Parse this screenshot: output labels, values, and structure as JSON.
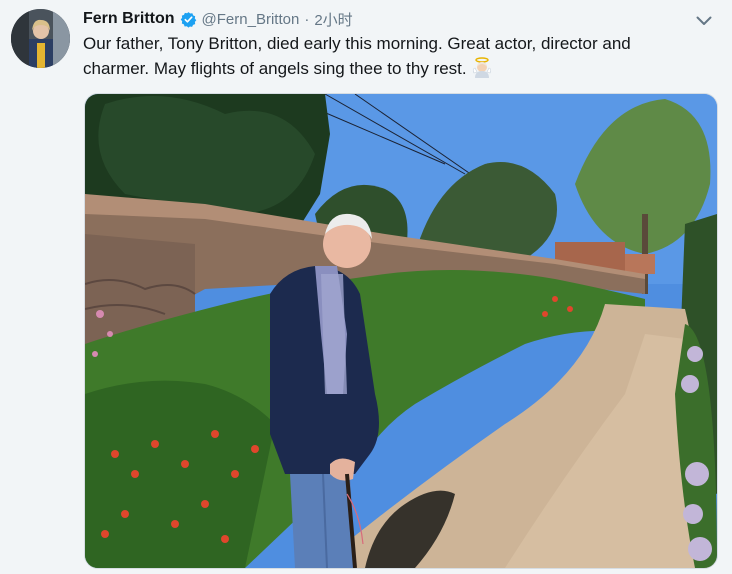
{
  "tweet": {
    "author_name": "Fern Britton",
    "handle": "@Fern_Britton",
    "separator": "·",
    "time": "2小时",
    "text": "Our father, Tony Britton, died early this morning. Great actor, director and charmer. May flights of angels sing thee to thy rest.",
    "emoji": "angel-emoji"
  },
  "colors": {
    "verified_blue": "#1da1f2",
    "secondary_text": "#657786",
    "primary_text": "#14171a"
  }
}
